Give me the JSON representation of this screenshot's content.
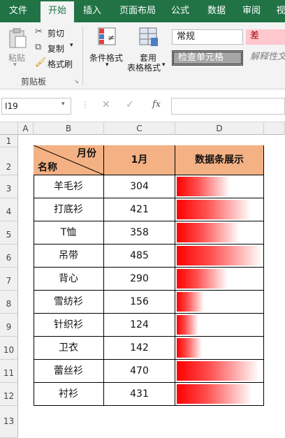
{
  "tabs": [
    "文件",
    "开始",
    "插入",
    "页面布局",
    "公式",
    "数据",
    "审阅",
    "视"
  ],
  "ribbon": {
    "paste": "粘贴",
    "cut": "剪切",
    "copy": "复制",
    "format_painter": "格式刷",
    "clipboard_group": "剪贴板",
    "conditional_format": "条件格式",
    "table_format_line1": "套用",
    "table_format_line2": "表格格式",
    "style_normal": "常规",
    "style_bad": "差",
    "style_check": "检查单元格",
    "style_explain": "解释性文"
  },
  "formula_bar": {
    "name_box": "I19",
    "fx": "fx"
  },
  "columns": [
    "A",
    "B",
    "C",
    "D"
  ],
  "rows": [
    "1",
    "2",
    "3",
    "4",
    "5",
    "6",
    "7",
    "8",
    "9",
    "10",
    "11",
    "12",
    "13"
  ],
  "table": {
    "header_month": "月份",
    "header_name": "名称",
    "header_jan": "1月",
    "header_bars": "数据条展示",
    "rows": [
      {
        "name": "羊毛衫",
        "value": "304"
      },
      {
        "name": "打底衫",
        "value": "421"
      },
      {
        "name": "T恤",
        "value": "358"
      },
      {
        "name": "吊带",
        "value": "485"
      },
      {
        "name": "背心",
        "value": "290"
      },
      {
        "name": "雪纺衫",
        "value": "156"
      },
      {
        "name": "针织衫",
        "value": "124"
      },
      {
        "name": "卫衣",
        "value": "142"
      },
      {
        "name": "蕾丝衫",
        "value": "470"
      },
      {
        "name": "衬衫",
        "value": "431"
      }
    ]
  },
  "colors": {
    "ribbon_green": "#217346",
    "header_fill": "#f4b183",
    "bar_red": "#ff0000"
  }
}
